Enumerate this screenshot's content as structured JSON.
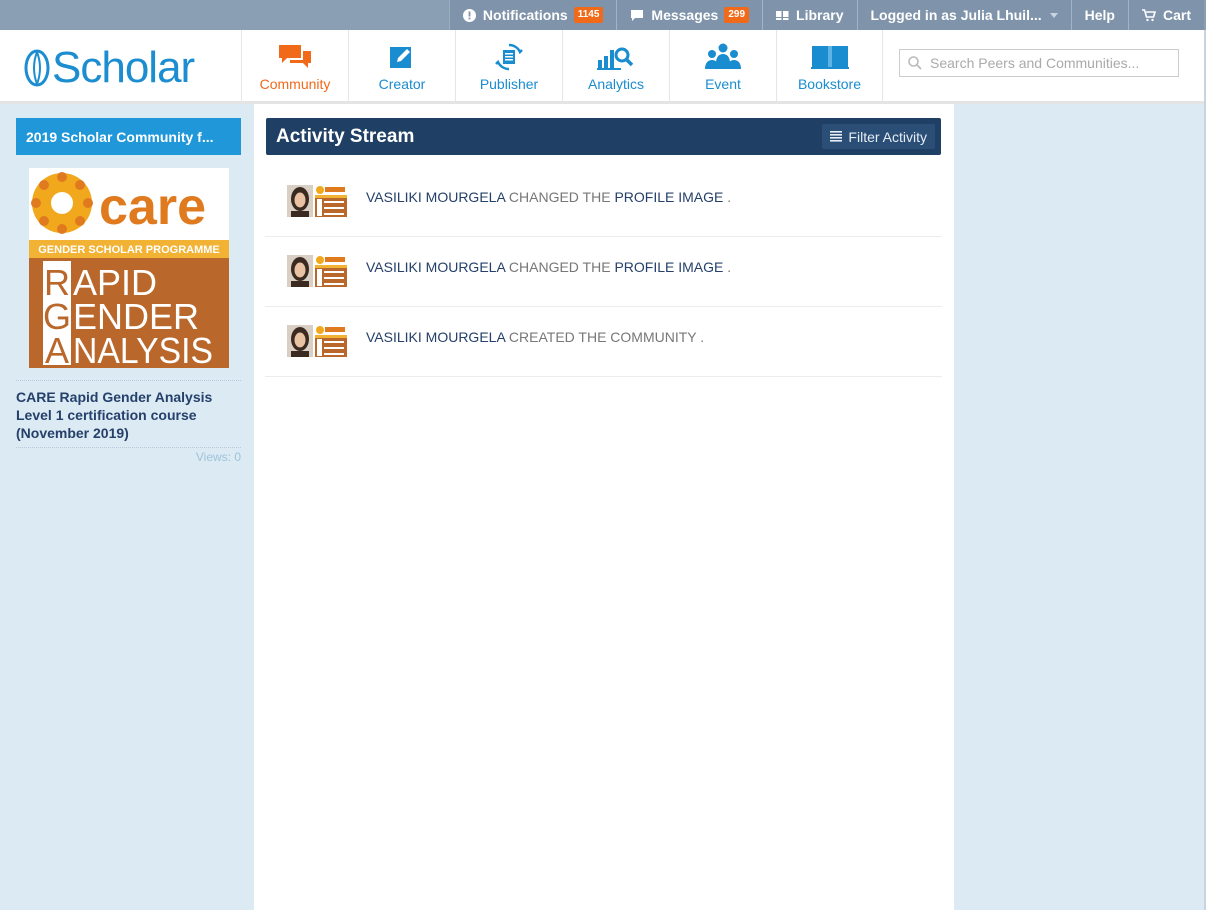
{
  "topbar": {
    "notifications": {
      "label": "Notifications",
      "count": "1145",
      "icon": "exclamation-circle-icon"
    },
    "messages": {
      "label": "Messages",
      "count": "299",
      "icon": "speech-bubble-icon"
    },
    "library": {
      "label": "Library",
      "icon": "book-icon"
    },
    "user": {
      "label": "Logged in as",
      "name": "Julia Lhuil..."
    },
    "help": {
      "label": "Help"
    },
    "cart": {
      "label": "Cart",
      "icon": "cart-icon"
    }
  },
  "header": {
    "logo_text": "Scholar",
    "nav": [
      {
        "label": "Community",
        "icon": "chat-bubbles-icon",
        "active": true
      },
      {
        "label": "Creator",
        "icon": "pencil-square-icon"
      },
      {
        "label": "Publisher",
        "icon": "refresh-document-icon"
      },
      {
        "label": "Analytics",
        "icon": "bar-chart-search-icon"
      },
      {
        "label": "Event",
        "icon": "people-group-icon"
      },
      {
        "label": "Bookstore",
        "icon": "open-book-icon"
      }
    ],
    "search": {
      "placeholder": "Search Peers and Communities..."
    }
  },
  "sidebar": {
    "community_button": "2019 Scholar Community f...",
    "image": {
      "care_text": "care",
      "subtitle": "GENDER SCHOLAR PROGRAMME",
      "line1_letter": "R",
      "line1_rest": "APID",
      "line2_letter": "G",
      "line2_rest": "ENDER",
      "line3_letter": "A",
      "line3_rest": "NALYSIS"
    },
    "course_title": "CARE Rapid Gender Analysis Level 1 certification course (November 2019)",
    "views": "Views: 0"
  },
  "stream": {
    "title": "Activity Stream",
    "filter_label": "Filter Activity",
    "items": [
      {
        "actor": "Vasiliki Mourgela",
        "verb": "changed the",
        "object": "profile image",
        "end": "."
      },
      {
        "actor": "Vasiliki Mourgela",
        "verb": "changed the",
        "object": "profile image",
        "end": "."
      },
      {
        "actor": "Vasiliki Mourgela",
        "verb": "created the",
        "object": "community",
        "end": "."
      }
    ]
  },
  "colors": {
    "accent_orange": "#f06a1a",
    "brand_blue": "#1b8dd0",
    "stream_header": "#1f3f64",
    "topbar": "#8a9eb4"
  }
}
